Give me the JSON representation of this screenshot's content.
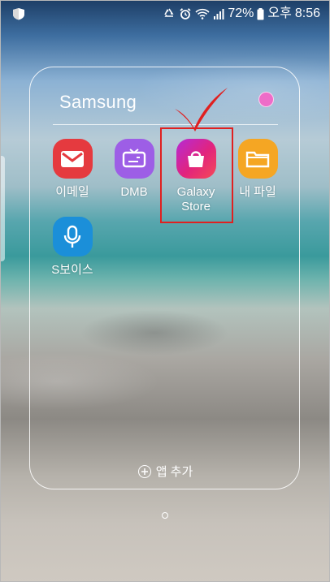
{
  "status_bar": {
    "battery_percent": "72%",
    "period": "오후",
    "time": "8:56",
    "icons": [
      "samsung-security-icon",
      "recycle-icon",
      "alarm-clock-icon",
      "wifi-icon",
      "signal-icon",
      "battery-icon"
    ]
  },
  "folder": {
    "title": "Samsung",
    "color_dot": "#ee6cc8",
    "apps": [
      {
        "label": "이메일",
        "icon": "email-icon",
        "color": "#e53a3f"
      },
      {
        "label": "DMB",
        "icon": "tv-icon",
        "color": "#9d5ee6"
      },
      {
        "label": "Galaxy Store",
        "icon": "shopping-bag-icon",
        "color": "#e2247c"
      },
      {
        "label": "내 파일",
        "icon": "folder-icon",
        "color": "#f5a623"
      },
      {
        "label": "S보이스",
        "icon": "microphone-icon",
        "color": "#1b8fd9"
      }
    ],
    "add_app_label": "앱 추가"
  },
  "annotation": {
    "highlight_color": "#e02020",
    "highlighted_app": "Galaxy Store"
  }
}
